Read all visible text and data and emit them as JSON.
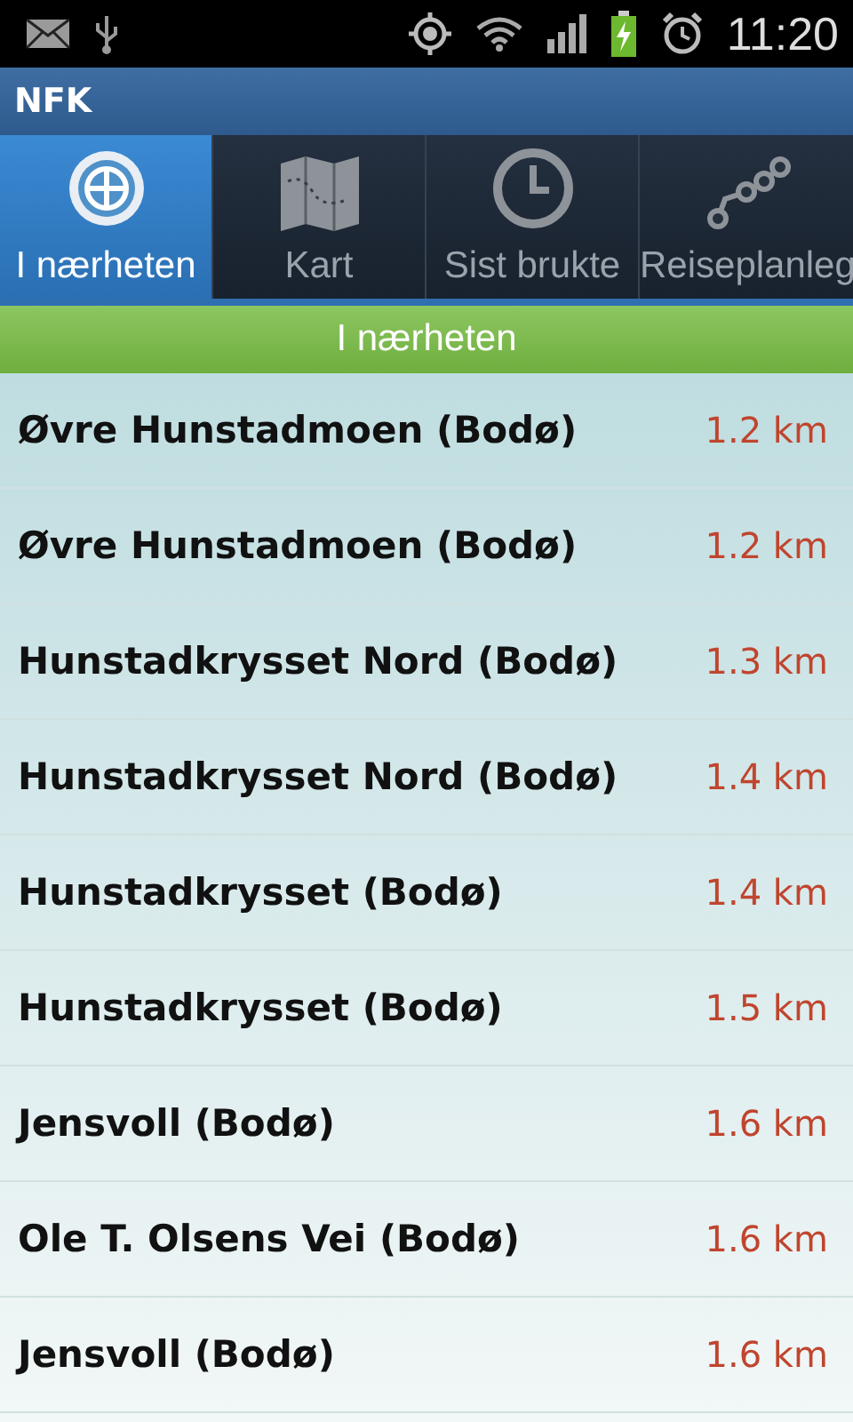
{
  "status_bar": {
    "time": "11:20"
  },
  "app_bar": {
    "title": "NFK"
  },
  "tabs": [
    {
      "label": "I nærheten",
      "kind": "target",
      "selected": true
    },
    {
      "label": "Kart",
      "kind": "map",
      "selected": false
    },
    {
      "label": "Sist brukte",
      "kind": "clock",
      "selected": false
    },
    {
      "label": "Reiseplanleg",
      "kind": "route",
      "selected": false
    }
  ],
  "section_header": "I nærheten",
  "stops": [
    {
      "name": "Øvre Hunstadmoen (Bodø)",
      "distance": "1.2 km"
    },
    {
      "name": "Øvre Hunstadmoen (Bodø)",
      "distance": "1.2 km"
    },
    {
      "name": "Hunstadkrysset Nord (Bodø)",
      "distance": "1.3 km"
    },
    {
      "name": "Hunstadkrysset Nord (Bodø)",
      "distance": "1.4 km"
    },
    {
      "name": "Hunstadkrysset (Bodø)",
      "distance": "1.4 km"
    },
    {
      "name": "Hunstadkrysset (Bodø)",
      "distance": "1.5 km"
    },
    {
      "name": "Jensvoll (Bodø)",
      "distance": "1.6 km"
    },
    {
      "name": "Ole T. Olsens Vei (Bodø)",
      "distance": "1.6 km"
    },
    {
      "name": "Jensvoll (Bodø)",
      "distance": "1.6 km"
    }
  ]
}
